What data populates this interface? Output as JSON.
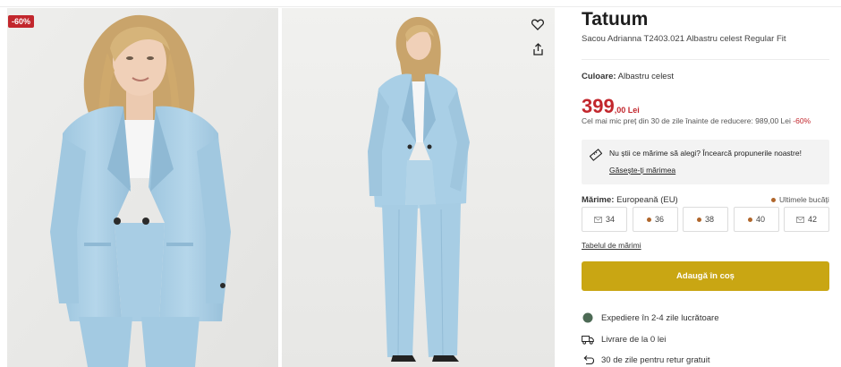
{
  "gallery": {
    "discount_badge": "-60%",
    "wishlist_icon": "heart-icon",
    "share_icon": "share-icon"
  },
  "product": {
    "brand": "Tatuum",
    "name": "Sacou Adrianna T2403.021 Albastru celest Regular Fit",
    "color_label": "Culoare:",
    "color_value": "Albastru celest",
    "price_int": "399",
    "price_dec": ",00 Lei",
    "price_note": "Cel mai mic preț din 30 de zile înainte de reducere: 989,00 Lei",
    "price_note_pct": "-60%"
  },
  "size_help": {
    "text": "Nu știi ce mărime să alegi? Încearcă propunerile noastre!",
    "link": "Găsește-ți mărimea"
  },
  "sizes": {
    "label": "Mărime:",
    "system": "Europeană (EU)",
    "last_items": "Ultimele bucăți",
    "options": [
      {
        "label": "34",
        "status": "notify"
      },
      {
        "label": "36",
        "status": "low"
      },
      {
        "label": "38",
        "status": "low"
      },
      {
        "label": "40",
        "status": "low"
      },
      {
        "label": "42",
        "status": "notify"
      }
    ],
    "table_link": "Tabelul de mărimi"
  },
  "cta": {
    "label": "Adaugă în coș"
  },
  "features": [
    {
      "icon": "green-dot-icon",
      "text": "Expediere în 2-4 zile lucrătoare"
    },
    {
      "icon": "truck-icon",
      "text": "Livrare de la 0 lei"
    },
    {
      "icon": "return-icon",
      "text": "30 de zile pentru retur gratuit"
    }
  ],
  "colors": {
    "accent_red": "#c2272d",
    "cta_gold": "#c9a613",
    "low_stock_dot": "#b0662b",
    "green_dot": "#4d6a55",
    "suit_blue": "#a9cfe6"
  }
}
